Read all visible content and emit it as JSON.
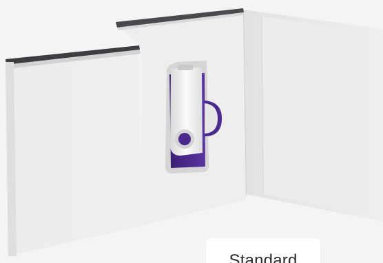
{
  "product": {
    "variant_label": "Standard",
    "device_color": "#4a2a8c",
    "case_color": "#ececec"
  }
}
